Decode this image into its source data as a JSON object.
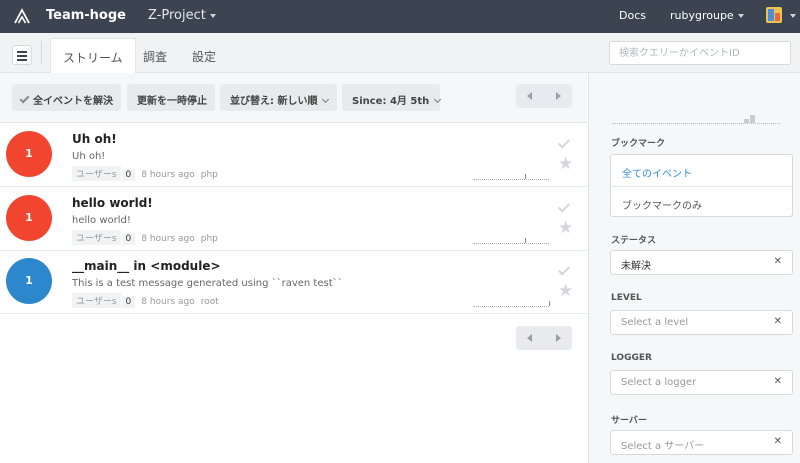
{
  "topbar": {
    "logo_icon": "sentry-logo-icon",
    "team": "Team-hoge",
    "project": "Z-Project",
    "docs": "Docs",
    "user": "rubygroupe",
    "bg_color": "#3c4452"
  },
  "subnav": {
    "tabs": [
      {
        "label": "ストリーム",
        "active": true
      },
      {
        "label": "調査",
        "active": false
      },
      {
        "label": "設定",
        "active": false
      }
    ],
    "search_placeholder": "検索クエリーかイベントID"
  },
  "toolbar": {
    "resolve_all": "全イベントを解決",
    "pause_updates": "更新を一時停止",
    "sort": "並び替え: 新しい順",
    "since": "Since: 4月 5th"
  },
  "events": [
    {
      "count": "1",
      "color": "#f2452f",
      "title": "Uh oh!",
      "message": "Uh oh!",
      "users_label": "ユーザーs",
      "users": "0",
      "time": "8 hours ago",
      "platform": "php"
    },
    {
      "count": "1",
      "color": "#f2452f",
      "title": "hello world!",
      "message": "hello world!",
      "users_label": "ユーザーs",
      "users": "0",
      "time": "8 hours ago",
      "platform": "php"
    },
    {
      "count": "1",
      "color": "#2d87cc",
      "title": "__main__ in <module>",
      "message": "This is a test message generated using ``raven test``",
      "users_label": "ユーザーs",
      "users": "0",
      "time": "8 hours ago",
      "platform": "root"
    }
  ],
  "sidebar": {
    "bookmarks_label": "ブックマーク",
    "bookmark_items": [
      {
        "label": "全てのイベント",
        "active": true
      },
      {
        "label": "ブックマークのみ",
        "active": false
      }
    ],
    "status_label": "ステータス",
    "status_value": "未解決",
    "level_label": "LEVEL",
    "level_placeholder": "Select a level",
    "logger_label": "LOGGER",
    "logger_placeholder": "Select a logger",
    "server_label": "サーバー",
    "server_placeholder": "Select a サーバー",
    "accent_color": "#2f8ee0"
  }
}
